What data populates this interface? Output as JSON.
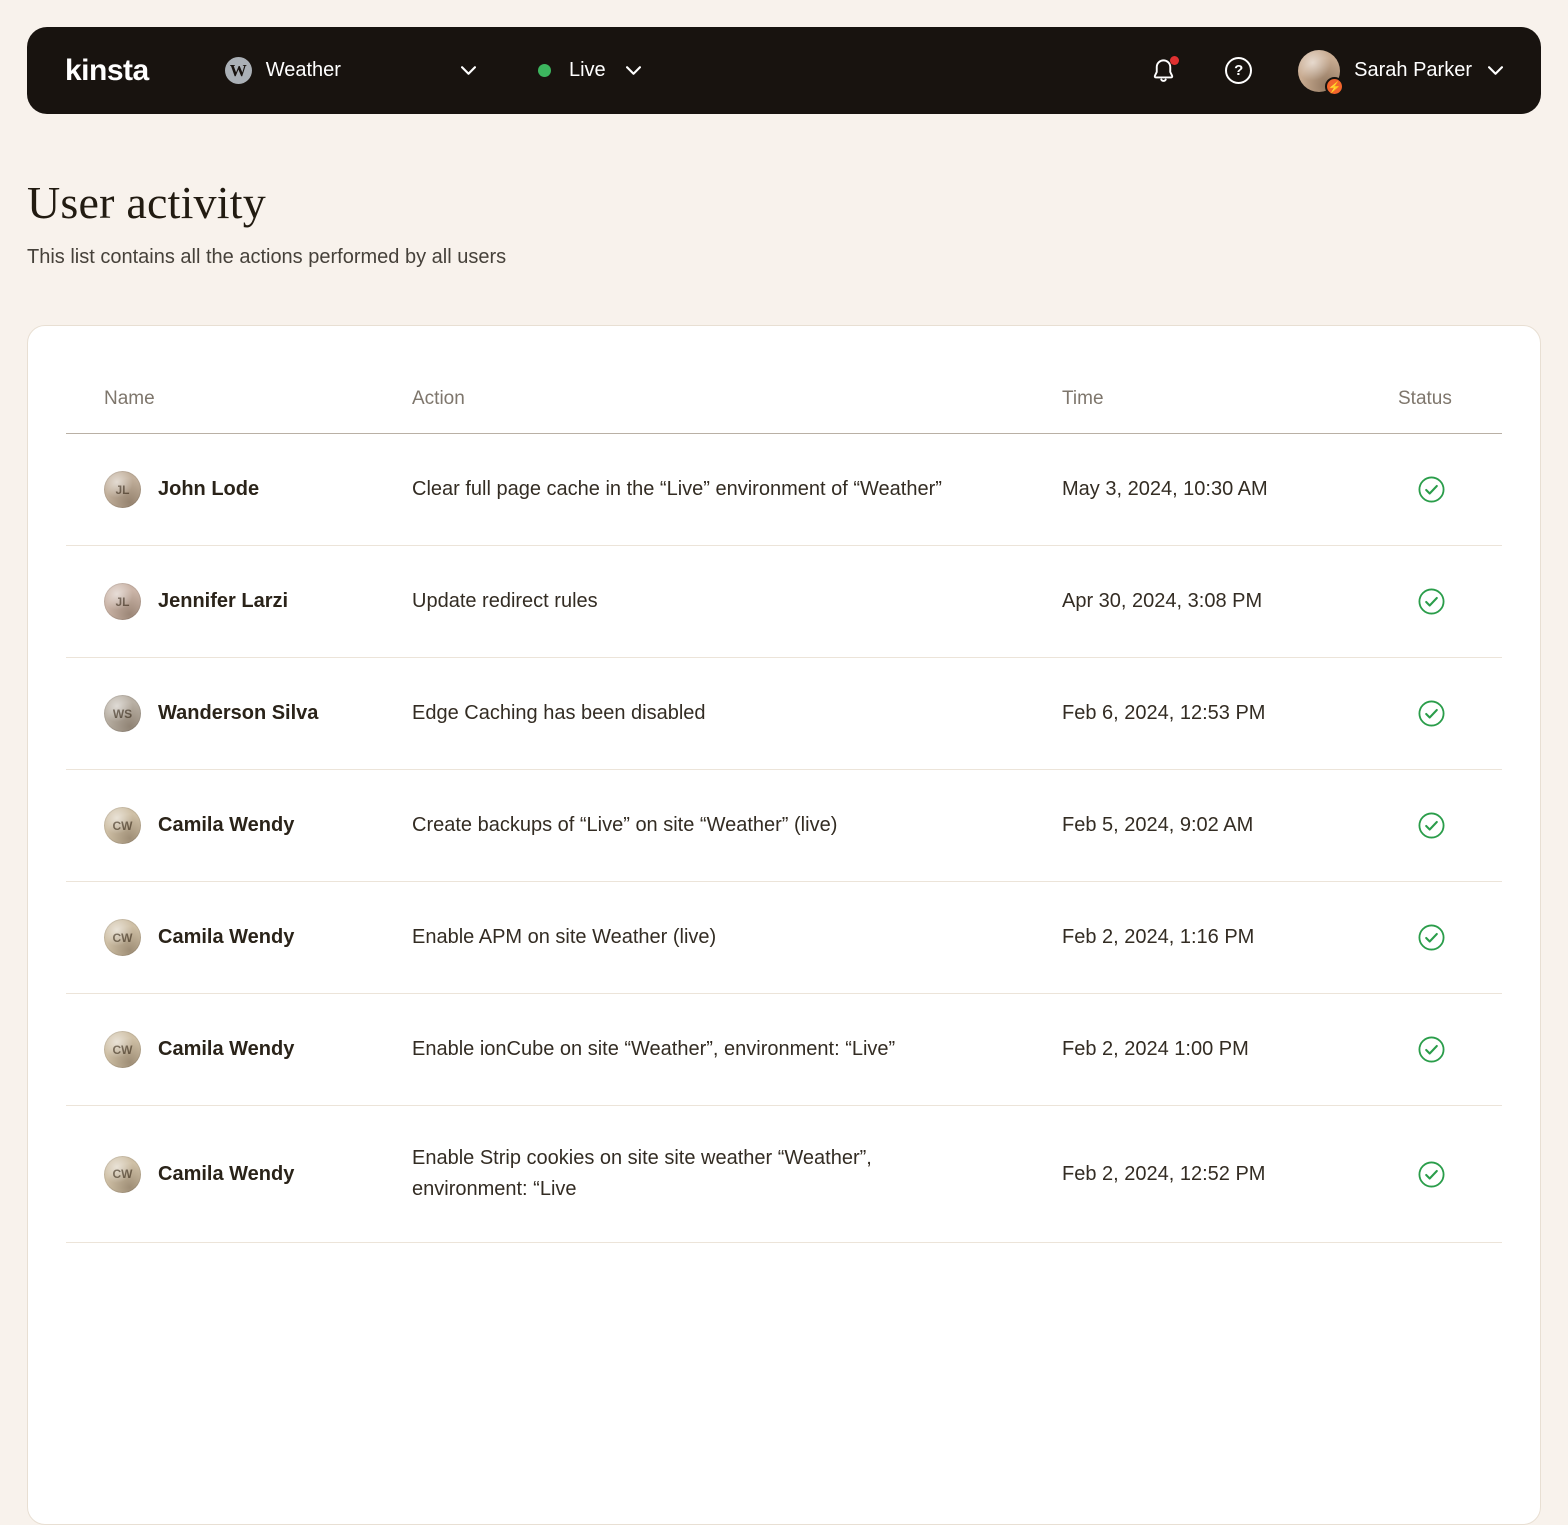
{
  "colors": {
    "nav_bg": "#18130f",
    "page_bg": "#f8f2ec",
    "success_green": "#2a9d4a",
    "live_green": "#3cb55e",
    "alert_red": "#e03131",
    "badge_orange": "#f2652c"
  },
  "navbar": {
    "logo_text": "kinsta",
    "site_selector": {
      "label": "Weather",
      "icon": "wordpress-icon"
    },
    "env_selector": {
      "label": "Live",
      "status_dot": "green"
    },
    "notifications": {
      "unread_dot": true
    },
    "user": {
      "name": "Sarah Parker"
    }
  },
  "page": {
    "title": "User activity",
    "subtitle": "This list contains all the actions performed by all users"
  },
  "table": {
    "columns": [
      "Name",
      "Action",
      "Time",
      "Status"
    ],
    "rows": [
      {
        "name": "John Lode",
        "initials": "JL",
        "avatar_color": "#c2b09c",
        "action": "Clear full page cache in the “Live” environment of “Weather”",
        "time": "May 3, 2024, 10:30 AM",
        "status": "success"
      },
      {
        "name": "Jennifer Larzi",
        "initials": "JL",
        "avatar_color": "#cbb5a8",
        "action": "Update redirect rules",
        "time": "Apr 30, 2024, 3:08 PM",
        "status": "success"
      },
      {
        "name": "Wanderson Silva",
        "initials": "WS",
        "avatar_color": "#b9b0a4",
        "action": "Edge Caching has been disabled",
        "time": "Feb 6, 2024, 12:53 PM",
        "status": "success"
      },
      {
        "name": "Camila Wendy",
        "initials": "CW",
        "avatar_color": "#cfc0a6",
        "action": "Create backups of “Live” on site “Weather” (live)",
        "time": "Feb 5, 2024, 9:02 AM",
        "status": "success"
      },
      {
        "name": "Camila Wendy",
        "initials": "CW",
        "avatar_color": "#cfc0a6",
        "action": "Enable APM on site Weather (live)",
        "time": "Feb 2, 2024, 1:16 PM",
        "status": "success"
      },
      {
        "name": "Camila Wendy",
        "initials": "CW",
        "avatar_color": "#cfc0a6",
        "action": "Enable ionCube on site “Weather”, environment: “Live”",
        "time": "Feb 2, 2024 1:00 PM",
        "status": "success"
      },
      {
        "name": "Camila Wendy",
        "initials": "CW",
        "avatar_color": "#cfc0a6",
        "action": "Enable Strip cookies on site site weather “Weather”, environment: “Live",
        "time": "Feb 2, 2024, 12:52 PM",
        "status": "success"
      }
    ]
  }
}
